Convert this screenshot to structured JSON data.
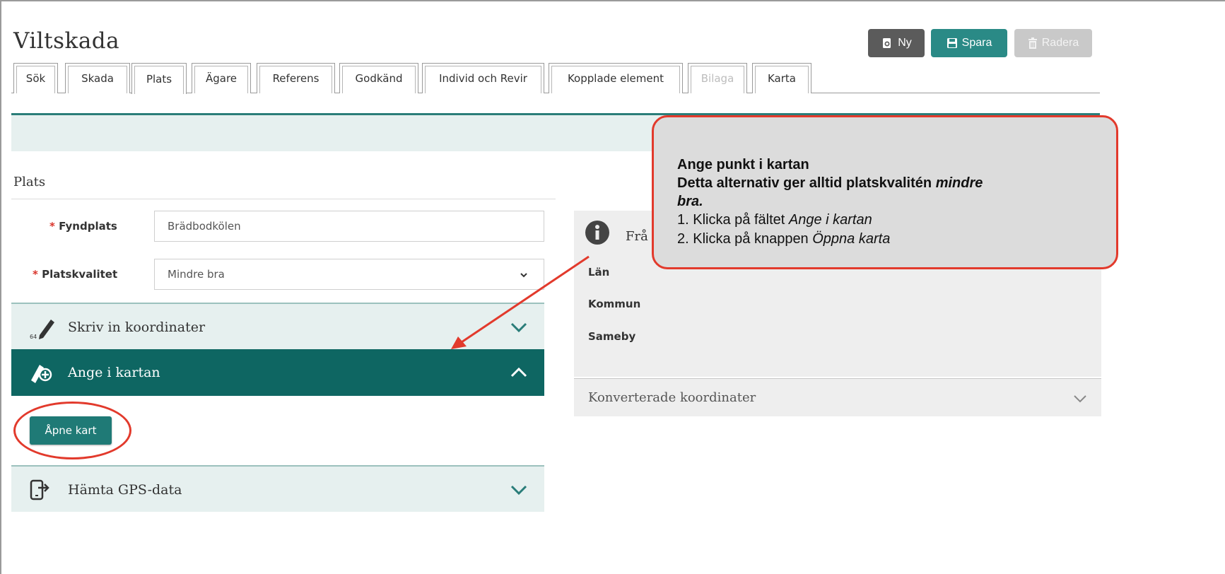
{
  "app": {
    "title": "Viltskada"
  },
  "toolbar": {
    "new_label": "Ny",
    "save_label": "Spara",
    "delete_label": "Radera"
  },
  "tabs": [
    {
      "label": "Sök",
      "state": "normal"
    },
    {
      "label": "Skada",
      "state": "normal"
    },
    {
      "label": "Plats",
      "state": "active"
    },
    {
      "label": "Ägare",
      "state": "normal"
    },
    {
      "label": "Referens",
      "state": "normal"
    },
    {
      "label": "Godkänd",
      "state": "normal"
    },
    {
      "label": "Individ och Revir",
      "state": "normal"
    },
    {
      "label": "Kopplade element",
      "state": "normal"
    },
    {
      "label": "Bilaga",
      "state": "disabled"
    },
    {
      "label": "Karta",
      "state": "normal"
    }
  ],
  "section": {
    "title": "Plats"
  },
  "form": {
    "fyndplats": {
      "label": "Fyndplats",
      "required_marker": "*",
      "value": "Brädbodkölen"
    },
    "platskvalitet": {
      "label": "Platskvalitet",
      "required_marker": "*",
      "value": "Mindre bra"
    }
  },
  "accordions": {
    "coordinates": {
      "label": "Skriv in koordinater",
      "icon": "pencil-coordinates-icon",
      "badge": "64",
      "expanded": false
    },
    "map": {
      "label": "Ange i kartan",
      "icon": "pen-plus-icon",
      "expanded": true,
      "button_label": "Åpne kart"
    },
    "gps": {
      "label": "Hämta GPS-data",
      "icon": "phone-import-icon",
      "expanded": false
    }
  },
  "info_panel": {
    "heading_visible": "Frå",
    "labels": [
      "Län",
      "Kommun",
      "Sameby"
    ]
  },
  "converted": {
    "label": "Konverterade koordinater"
  },
  "callout": {
    "title": "Ange punkt i kartan",
    "line2": "Detta alternativ ger alltid platskvalitén ",
    "line2_em": "mindre",
    "line3": "bra.",
    "step1_prefix": "1.  Klicka på fältet ",
    "step1_em": "Ange i kartan",
    "step2_prefix": "2.  Klicka på knappen ",
    "step2_em": "Öppna karta"
  },
  "colors": {
    "teal": "#2a8a86",
    "dark_teal": "#0e6662",
    "light_teal_band": "#e6f0ef",
    "annotation_red": "#e23a2c",
    "required_red": "#d9342b"
  }
}
